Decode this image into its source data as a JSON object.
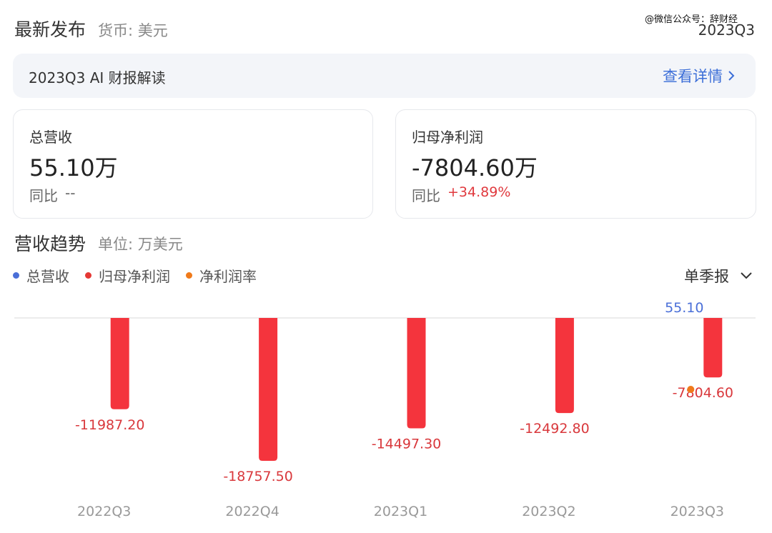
{
  "header": {
    "title": "最新发布",
    "currency": "货币: 美元",
    "watermark": "@微信公众号：辞财经",
    "period": "2023Q3"
  },
  "ai_bar": {
    "label": "2023Q3 AI 财报解读",
    "link": "查看详情"
  },
  "cards": {
    "revenue": {
      "label": "总营收",
      "value": "55.10万",
      "yoy_label": "同比",
      "yoy_value": "--"
    },
    "net_profit": {
      "label": "归母净利润",
      "value": "-7804.60万",
      "yoy_label": "同比",
      "yoy_value": "+34.89%"
    }
  },
  "trend": {
    "title": "营收趋势",
    "unit": "单位: 万美元",
    "period_select": "单季报"
  },
  "legend": [
    {
      "label": "总营收",
      "color": "#4a6fd8"
    },
    {
      "label": "归母净利润",
      "color": "#e53935"
    },
    {
      "label": "净利润率",
      "color": "#f07a1a"
    }
  ],
  "chart_data": {
    "type": "bar",
    "categories": [
      "2022Q3",
      "2022Q4",
      "2023Q1",
      "2023Q2",
      "2023Q3"
    ],
    "series": [
      {
        "name": "总营收",
        "values": [
          null,
          null,
          null,
          null,
          55.1
        ],
        "color": "#4a6fd8"
      },
      {
        "name": "归母净利润",
        "values": [
          -11987.2,
          -18757.5,
          -14497.3,
          -12492.8,
          -7804.6
        ],
        "color": "#f4343d"
      }
    ],
    "data_labels": {
      "总营收": [
        null,
        null,
        null,
        null,
        "55.10"
      ],
      "归母净利润": [
        "-11987.20",
        "-18757.50",
        "-14497.30",
        "-12492.80",
        "-7804.60"
      ]
    },
    "net_margin_marker_index": 4,
    "net_margin_color": "#f07a1a"
  }
}
